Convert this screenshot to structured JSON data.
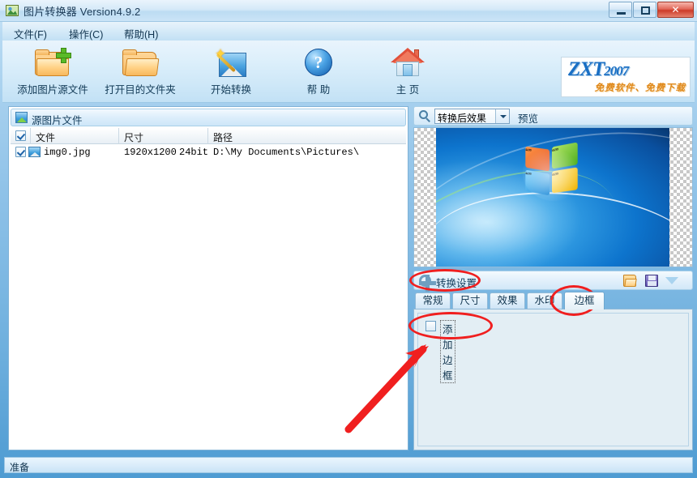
{
  "window": {
    "title": "图片转换器 Version4.9.2",
    "icon": "app-icon",
    "controls": {
      "minimize": "–",
      "maximize": "□",
      "close": "✕"
    }
  },
  "menubar": {
    "items": [
      {
        "label": "文件(F)",
        "name": "menu-file"
      },
      {
        "label": "操作(C)",
        "name": "menu-operation"
      },
      {
        "label": "帮助(H)",
        "name": "menu-help"
      }
    ]
  },
  "toolbar": {
    "buttons": [
      {
        "label": "添加图片源文件",
        "icon": "folder-add-icon"
      },
      {
        "label": "打开目的文件夹",
        "icon": "folder-open-icon"
      },
      {
        "label": "开始转换",
        "icon": "magic-wand-image-icon"
      },
      {
        "label": "帮 助",
        "icon": "help-question-icon"
      },
      {
        "label": "主 页",
        "icon": "home-icon"
      }
    ],
    "banner": {
      "title": "ZXT",
      "title_sub": "2007",
      "slogan": "免费软件、免费下载"
    },
    "top_link": "免费软件"
  },
  "file_list": {
    "header": "源图片文件",
    "header_icon": "image-icon",
    "select_all_checked": true,
    "columns": [
      "文件",
      "尺寸",
      "路径"
    ],
    "rows": [
      {
        "checked": true,
        "icon": "image-thumb-icon",
        "file": "img0.jpg",
        "size": "1920x1200",
        "depth": "24bit",
        "path": "D:\\My Documents\\Pictures\\"
      }
    ]
  },
  "preview": {
    "icon": "magnifier-icon",
    "mode": "转换后效果",
    "label": "预览",
    "image_alt": "windows-7-wallpaper"
  },
  "settings": {
    "title": "转换设置",
    "icon": "gear-icon",
    "actions": [
      {
        "name": "load-settings-icon",
        "label": "打开"
      },
      {
        "name": "save-settings-icon",
        "label": "保存"
      },
      {
        "name": "chevron-down-icon",
        "label": "更多"
      }
    ],
    "tabs": [
      {
        "label": "常规",
        "active": false
      },
      {
        "label": "尺寸",
        "active": false
      },
      {
        "label": "效果",
        "active": false
      },
      {
        "label": "水印",
        "active": false
      },
      {
        "label": "边框",
        "active": true
      }
    ],
    "border_tab": {
      "add_border_label": "添加边框",
      "add_border_checked": false
    }
  },
  "statusbar": {
    "text": "准备"
  },
  "annotations": {
    "accent_color": "#f01f1f",
    "marks": [
      "ellipse-settings-title",
      "ellipse-border-tab",
      "ellipse-add-border",
      "arrow-to-add-border"
    ]
  }
}
